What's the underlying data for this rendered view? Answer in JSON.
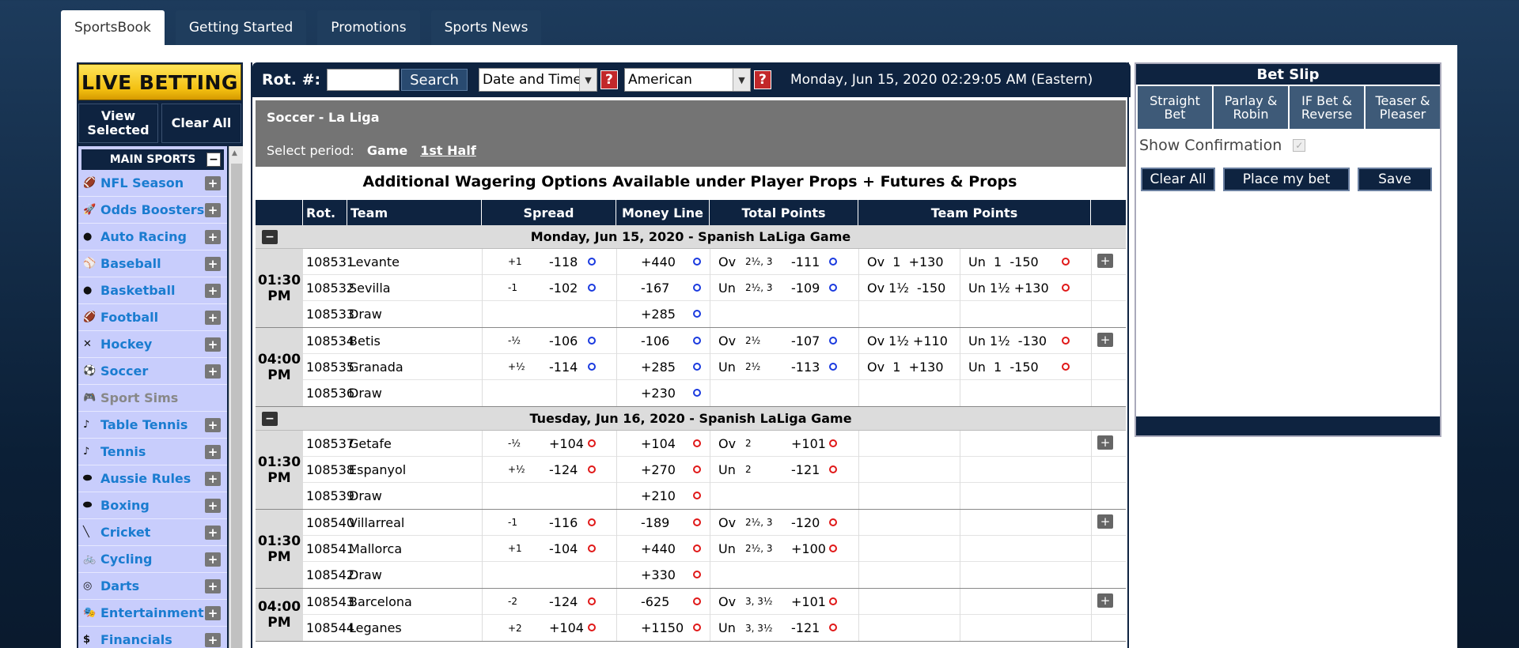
{
  "tabs": [
    "SportsBook",
    "Getting Started",
    "Promotions",
    "Sports News"
  ],
  "left": {
    "live_label": "LIVE BETTING",
    "view_selected": "View Selected",
    "clear_all": "Clear All",
    "main_sports": "MAIN SPORTS",
    "sports": [
      {
        "label": "NFL Season",
        "icon": "football-icon",
        "glyph": "🏈",
        "expand": true
      },
      {
        "label": "Odds Boosters",
        "icon": "rocket-icon",
        "glyph": "🚀",
        "expand": true
      },
      {
        "label": "Auto Racing",
        "icon": "racing-car-icon",
        "glyph": "●",
        "expand": true
      },
      {
        "label": "Baseball",
        "icon": "baseball-icon",
        "glyph": "⚾",
        "expand": true
      },
      {
        "label": "Basketball",
        "icon": "basketball-icon",
        "glyph": "●",
        "expand": true
      },
      {
        "label": "Football",
        "icon": "football-icon",
        "glyph": "🏈",
        "expand": true
      },
      {
        "label": "Hockey",
        "icon": "hockey-icon",
        "glyph": "✕",
        "expand": true
      },
      {
        "label": "Soccer",
        "icon": "soccer-ball-icon",
        "glyph": "⚽",
        "expand": true
      },
      {
        "label": "Sport Sims",
        "icon": "gamepad-icon",
        "glyph": "🎮",
        "expand": false,
        "gray": true
      },
      {
        "label": "Table Tennis",
        "icon": "table-tennis-icon",
        "glyph": "♪",
        "expand": true
      },
      {
        "label": "Tennis",
        "icon": "tennis-icon",
        "glyph": "♪",
        "expand": true
      },
      {
        "label": "Aussie Rules",
        "icon": "aussie-rules-icon",
        "glyph": "⬬",
        "expand": true
      },
      {
        "label": "Boxing",
        "icon": "boxing-glove-icon",
        "glyph": "⬬",
        "expand": true
      },
      {
        "label": "Cricket",
        "icon": "cricket-bat-icon",
        "glyph": "╲",
        "expand": true
      },
      {
        "label": "Cycling",
        "icon": "bicycle-icon",
        "glyph": "🚲",
        "expand": true
      },
      {
        "label": "Darts",
        "icon": "dartboard-icon",
        "glyph": "◎",
        "expand": true
      },
      {
        "label": "Entertainment",
        "icon": "masks-icon",
        "glyph": "🎭",
        "expand": true
      },
      {
        "label": "Financials",
        "icon": "dollar-icon",
        "glyph": "$",
        "expand": true
      }
    ]
  },
  "toolbar": {
    "rot_label": "Rot. #:",
    "search": "Search",
    "sort_value": "Date and Time",
    "odds_value": "American",
    "datetime": "Monday, Jun 15, 2020 02:29:05 AM (Eastern)"
  },
  "league": {
    "title": "Soccer - La Liga",
    "period_label": "Select period:",
    "period_game": "Game",
    "period_half": "1st Half"
  },
  "notice": "Additional Wagering Options Available under Player Props + Futures & Props",
  "headers": {
    "rot": "Rot.",
    "team": "Team",
    "spread": "Spread",
    "ml": "Money Line",
    "tp": "Total Points",
    "teamp": "Team Points"
  },
  "days": [
    {
      "label": "Monday, Jun 15, 2020 - Spanish LaLiga Game",
      "games": [
        {
          "time": "01:30 PM",
          "oc": "b",
          "tpc": "r",
          "rows": [
            {
              "rot": "108531",
              "team": "Levante",
              "sp": "+1",
              "spo": "-118",
              "ml": "+440",
              "tpl": "Ov",
              "tpv": "2½, 3",
              "tpo": "-111",
              "t1": "Ov  1  +130",
              "t2": "Un  1  -150"
            },
            {
              "rot": "108532",
              "team": "Sevilla",
              "sp": "-1",
              "spo": "-102",
              "ml": "-167",
              "tpl": "Un",
              "tpv": "2½, 3",
              "tpo": "-109",
              "t1": "Ov 1½  -150",
              "t2": "Un 1½ +130"
            },
            {
              "rot": "108533",
              "team": "Draw",
              "sp": "",
              "spo": "",
              "ml": "+285",
              "tpl": "",
              "tpv": "",
              "tpo": "",
              "t1": "",
              "t2": ""
            }
          ]
        },
        {
          "time": "04:00 PM",
          "oc": "b",
          "tpc": "r",
          "rows": [
            {
              "rot": "108534",
              "team": "Betis",
              "sp": "-½",
              "spo": "-106",
              "ml": "-106",
              "tpl": "Ov",
              "tpv": "2½",
              "tpo": "-107",
              "t1": "Ov 1½ +110",
              "t2": "Un 1½  -130"
            },
            {
              "rot": "108535",
              "team": "Granada",
              "sp": "+½",
              "spo": "-114",
              "ml": "+285",
              "tpl": "Un",
              "tpv": "2½",
              "tpo": "-113",
              "t1": "Ov  1  +130",
              "t2": "Un  1  -150"
            },
            {
              "rot": "108536",
              "team": "Draw",
              "sp": "",
              "spo": "",
              "ml": "+230",
              "tpl": "",
              "tpv": "",
              "tpo": "",
              "t1": "",
              "t2": ""
            }
          ]
        }
      ]
    },
    {
      "label": "Tuesday, Jun 16, 2020 - Spanish LaLiga Game",
      "games": [
        {
          "time": "01:30 PM",
          "oc": "r",
          "tpc": "r",
          "rows": [
            {
              "rot": "108537",
              "team": "Getafe",
              "sp": "-½",
              "spo": "+104",
              "ml": "+104",
              "tpl": "Ov",
              "tpv": "2",
              "tpo": "+101",
              "t1": "",
              "t2": ""
            },
            {
              "rot": "108538",
              "team": "Espanyol",
              "sp": "+½",
              "spo": "-124",
              "ml": "+270",
              "tpl": "Un",
              "tpv": "2",
              "tpo": "-121",
              "t1": "",
              "t2": ""
            },
            {
              "rot": "108539",
              "team": "Draw",
              "sp": "",
              "spo": "",
              "ml": "+210",
              "tpl": "",
              "tpv": "",
              "tpo": "",
              "t1": "",
              "t2": ""
            }
          ]
        },
        {
          "time": "01:30 PM",
          "oc": "r",
          "tpc": "r",
          "rows": [
            {
              "rot": "108540",
              "team": "Villarreal",
              "sp": "-1",
              "spo": "-116",
              "ml": "-189",
              "tpl": "Ov",
              "tpv": "2½, 3",
              "tpo": "-120",
              "t1": "",
              "t2": ""
            },
            {
              "rot": "108541",
              "team": "Mallorca",
              "sp": "+1",
              "spo": "-104",
              "ml": "+440",
              "tpl": "Un",
              "tpv": "2½, 3",
              "tpo": "+100",
              "t1": "",
              "t2": ""
            },
            {
              "rot": "108542",
              "team": "Draw",
              "sp": "",
              "spo": "",
              "ml": "+330",
              "tpl": "",
              "tpv": "",
              "tpo": "",
              "t1": "",
              "t2": ""
            }
          ]
        },
        {
          "time": "04:00 PM",
          "oc": "r",
          "tpc": "r",
          "rows": [
            {
              "rot": "108543",
              "team": "Barcelona",
              "sp": "-2",
              "spo": "-124",
              "ml": "-625",
              "tpl": "Ov",
              "tpv": "3, 3½",
              "tpo": "+101",
              "t1": "",
              "t2": ""
            },
            {
              "rot": "108544",
              "team": "Leganes",
              "sp": "+2",
              "spo": "+104",
              "ml": "+1150",
              "tpl": "Un",
              "tpv": "3, 3½",
              "tpo": "-121",
              "t1": "",
              "t2": ""
            }
          ]
        }
      ]
    }
  ],
  "betslip": {
    "title": "Bet Slip",
    "tabs": [
      "Straight Bet",
      "Parlay & Robin",
      "IF Bet & Reverse",
      "Teaser & Pleaser"
    ],
    "confirm": "Show Confirmation",
    "clear": "Clear All",
    "place": "Place my bet",
    "save": "Save"
  },
  "colors": {
    "navy": "#0e2340",
    "blue_odds": "#1a3adf",
    "red_odds": "#e01818",
    "link": "#1a7cd0"
  }
}
